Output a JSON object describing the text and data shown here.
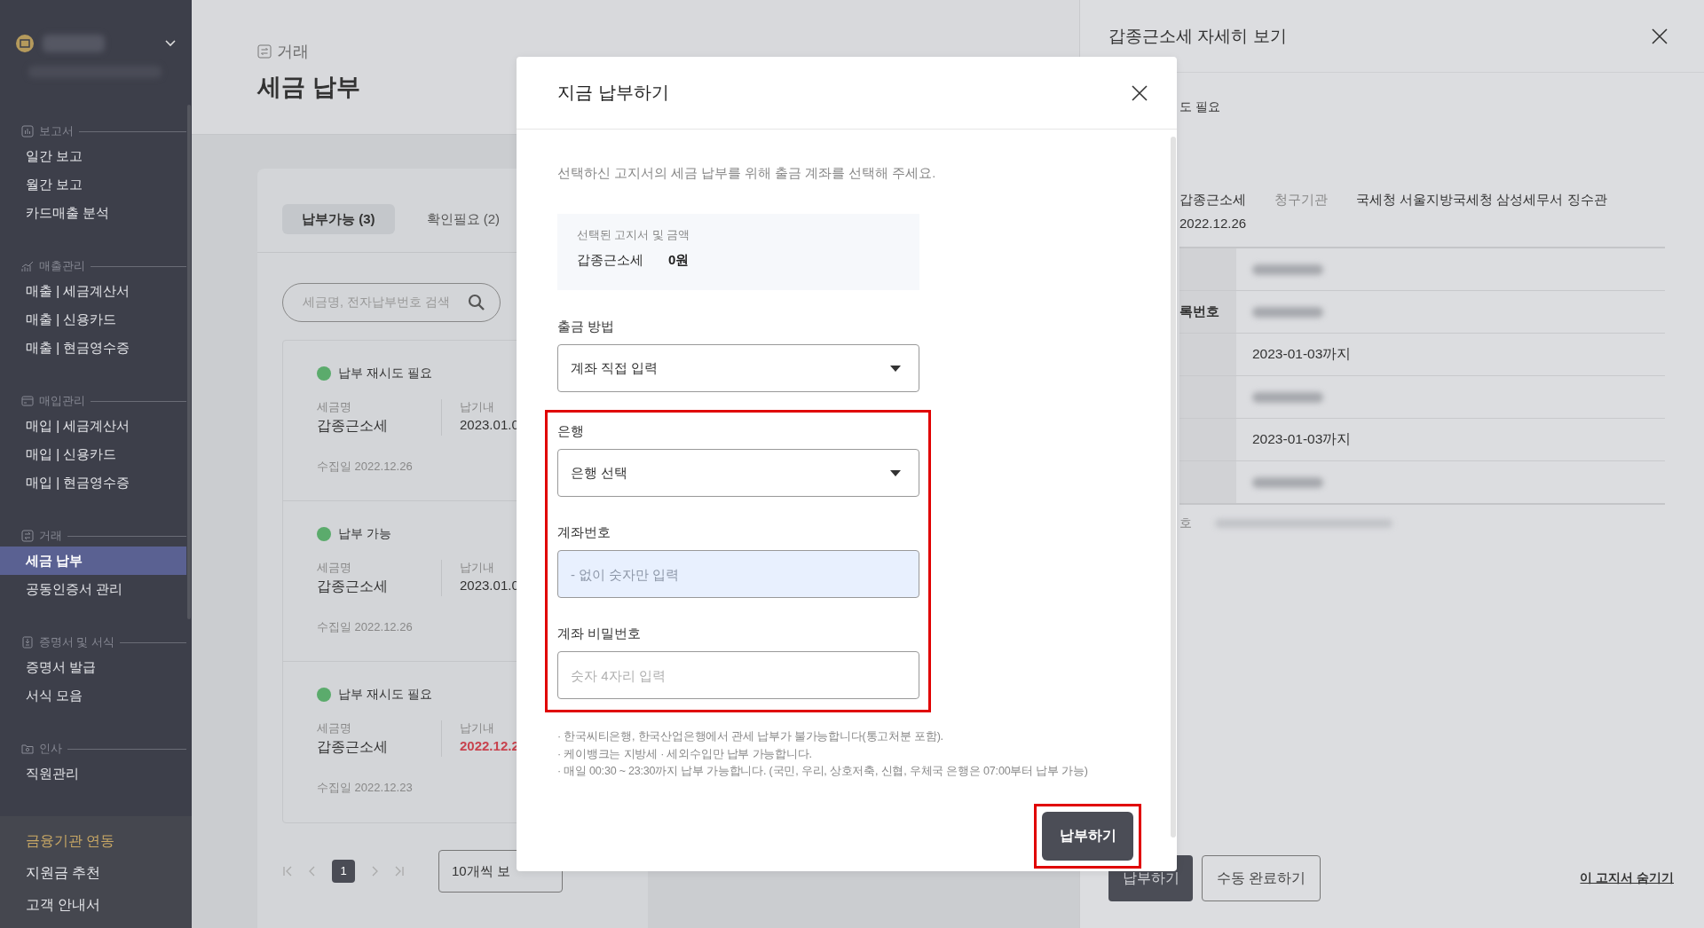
{
  "sidebar": {
    "brand": {
      "redacted": true
    },
    "sections": [
      {
        "title": "보고서",
        "items": [
          {
            "label": "일간 보고",
            "selected": false
          },
          {
            "label": "월간 보고",
            "selected": false
          },
          {
            "label": "카드매출 분석",
            "selected": false
          }
        ]
      },
      {
        "title": "매출관리",
        "items": [
          {
            "label": "매출 | 세금계산서",
            "selected": false
          },
          {
            "label": "매출 | 신용카드",
            "selected": false
          },
          {
            "label": "매출 | 현금영수증",
            "selected": false
          }
        ]
      },
      {
        "title": "매입관리",
        "items": [
          {
            "label": "매입 | 세금계산서",
            "selected": false
          },
          {
            "label": "매입 | 신용카드",
            "selected": false
          },
          {
            "label": "매입 | 현금영수증",
            "selected": false
          }
        ]
      },
      {
        "title": "거래",
        "items": [
          {
            "label": "세금 납부",
            "selected": true
          },
          {
            "label": "공동인증서 관리",
            "selected": false
          }
        ]
      },
      {
        "title": "증명서 및 서식",
        "items": [
          {
            "label": "증명서 발급",
            "selected": false
          },
          {
            "label": "서식 모음",
            "selected": false
          }
        ]
      },
      {
        "title": "인사",
        "items": [
          {
            "label": "직원관리",
            "selected": false
          }
        ]
      }
    ],
    "footer_items": [
      {
        "label": "금융기관 연동",
        "accent": true
      },
      {
        "label": "지원금 추천",
        "accent": false
      },
      {
        "label": "고객 안내서",
        "accent": false
      }
    ]
  },
  "main": {
    "breadcrumb": "거래",
    "title": "세금 납부",
    "tabs": [
      {
        "label": "납부가능 (3)",
        "selected": true
      },
      {
        "label": "확인필요 (2)",
        "selected": false
      }
    ],
    "search": {
      "placeholder": "세금명, 전자납부번호 검색"
    },
    "bills": [
      {
        "status": "납부 재시도 필요",
        "color": "#5bab6c",
        "name_label": "세금명",
        "name": "갑종근소세",
        "due_label": "납기내",
        "due": "2023.01.0",
        "overdue": false,
        "collected": "수집일 2022.12.26"
      },
      {
        "status": "납부 가능",
        "color": "#5bab6c",
        "name_label": "세금명",
        "name": "갑종근소세",
        "due_label": "납기내",
        "due": "2023.01.0",
        "overdue": false,
        "collected": "수집일 2022.12.26"
      },
      {
        "status": "납부 재시도 필요",
        "color": "#5bab6c",
        "name_label": "세금명",
        "name": "갑종근소세",
        "due_label": "납기내",
        "due": "2022.12.2",
        "overdue": true,
        "collected": "수집일 2022.12.23"
      }
    ],
    "pagination": {
      "pages": [
        {
          "label": "1",
          "selected": true
        }
      ],
      "page_size": "10개씩 보"
    }
  },
  "detail_panel": {
    "title": "갑종근소세 자세히 보기",
    "status": "도 필요",
    "info": [
      {
        "kind": "value",
        "text": "갑종근소세"
      },
      {
        "kind": "label",
        "text": "청구기관"
      },
      {
        "kind": "value",
        "text": "국세청 서울지방국세청 삼성세무서 징수관"
      }
    ],
    "date": "2022.12.26",
    "rows": [
      {
        "kind": "redacted"
      },
      {
        "kind": "redacted",
        "label": "록번호"
      },
      {
        "kind": "text",
        "value": "2023-01-03까지"
      },
      {
        "kind": "redacted"
      },
      {
        "kind": "text",
        "value": "2023-01-03까지"
      },
      {
        "kind": "redacted"
      }
    ],
    "extra": {
      "label": "호",
      "kind": "redacted"
    },
    "buttons": [
      {
        "label": "납부하기",
        "kind": "primary"
      },
      {
        "label": "수동 완료하기",
        "kind": "outline"
      }
    ],
    "hide_link": "이 고지서 숨기기"
  },
  "modal": {
    "title": "지금 납부하기",
    "description": "선택하신 고지서의 세금 납부를 위해 출금 계좌를 선택해 주세요.",
    "summary": {
      "label": "선택된 고지서 및 금액",
      "name": "갑종근소세",
      "amount": "0원"
    },
    "method": {
      "kind": "select",
      "label": "출금 방법",
      "value": "계좌 직접 입력"
    },
    "bank_group": {
      "highlighted": true,
      "fields": [
        {
          "kind": "select",
          "label": "은행",
          "value": "은행 선택"
        },
        {
          "kind": "input",
          "label": "계좌번호",
          "placeholder": "- 없이 숫자만 입력",
          "autofilled": true
        },
        {
          "kind": "input",
          "label": "계좌 비밀번호",
          "placeholder": "숫자 4자리 입력",
          "autofilled": false
        }
      ]
    },
    "notes": [
      "· 한국씨티은행, 한국산업은행에서 관세 납부가 불가능합니다(통고처분 포함).",
      "· 케이뱅크는 지방세 · 세외수입만 납부 가능합니다.",
      "· 매일 00:30 ~ 23:30까지 납부 가능합니다. (국민, 우리, 상호저축, 신협, 우체국 은행은 07:00부터 납부 가능)"
    ],
    "submit": {
      "label": "납부하기",
      "highlighted": true
    }
  }
}
